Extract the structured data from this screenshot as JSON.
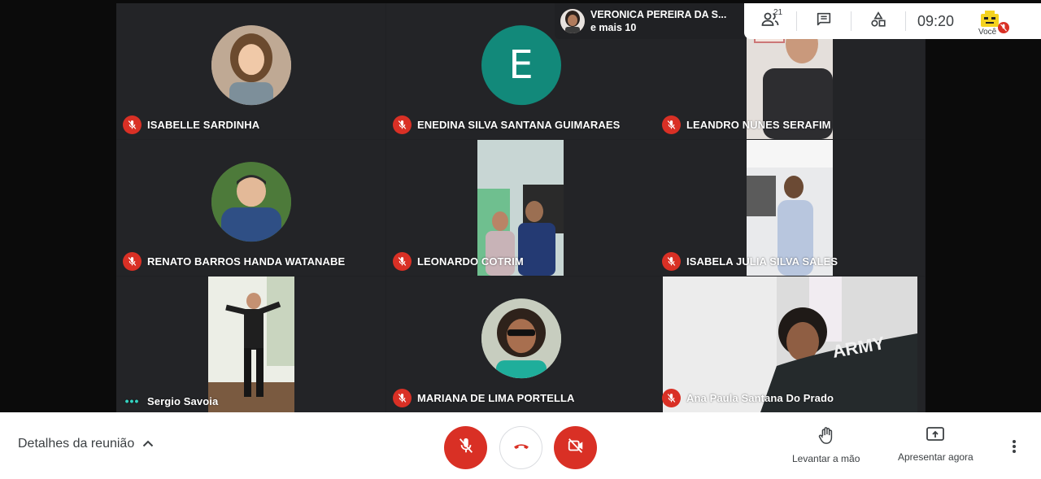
{
  "presenter": {
    "name": "VERONICA PEREIRA DA S...",
    "more": "e mais 10"
  },
  "topbar": {
    "people_count": "21",
    "time": "09:20",
    "you_label": "Você"
  },
  "tiles": [
    {
      "name": "ISABELLE SARDINHA",
      "status": "muted"
    },
    {
      "name": "ENEDINA SILVA SANTANA GUIMARAES",
      "status": "muted",
      "initial": "E"
    },
    {
      "name": "LEANDRO NUNES SERAFIM",
      "status": "muted"
    },
    {
      "name": "RENATO BARROS HANDA WATANABE",
      "status": "muted"
    },
    {
      "name": "LEONARDO COTRIM",
      "status": "muted"
    },
    {
      "name": "ISABELA JULIA SILVA SALES",
      "status": "muted"
    },
    {
      "name": "Sergio Savoia",
      "status": "speaking"
    },
    {
      "name": "MARIANA DE LIMA PORTELLA",
      "status": "muted"
    },
    {
      "name": "Ana Paula Santana Do Prado",
      "status": "muted"
    }
  ],
  "bottom": {
    "details_label": "Detalhes da reunião",
    "raise_hand_label": "Levantar a mão",
    "present_label": "Apresentar agora"
  },
  "icons": {
    "people": "people-icon",
    "chat": "chat-icon",
    "activities": "activities-icon",
    "mic_off": "mic-off-icon",
    "hangup": "hangup-icon",
    "cam_off": "camera-off-icon",
    "hand": "raise-hand-icon",
    "present": "present-icon",
    "more": "more-vert-icon"
  },
  "colors": {
    "danger": "#d93025",
    "tile_bg": "#232427",
    "teal_avatar": "#12897a",
    "speaking_dots": "#34d3c1"
  }
}
